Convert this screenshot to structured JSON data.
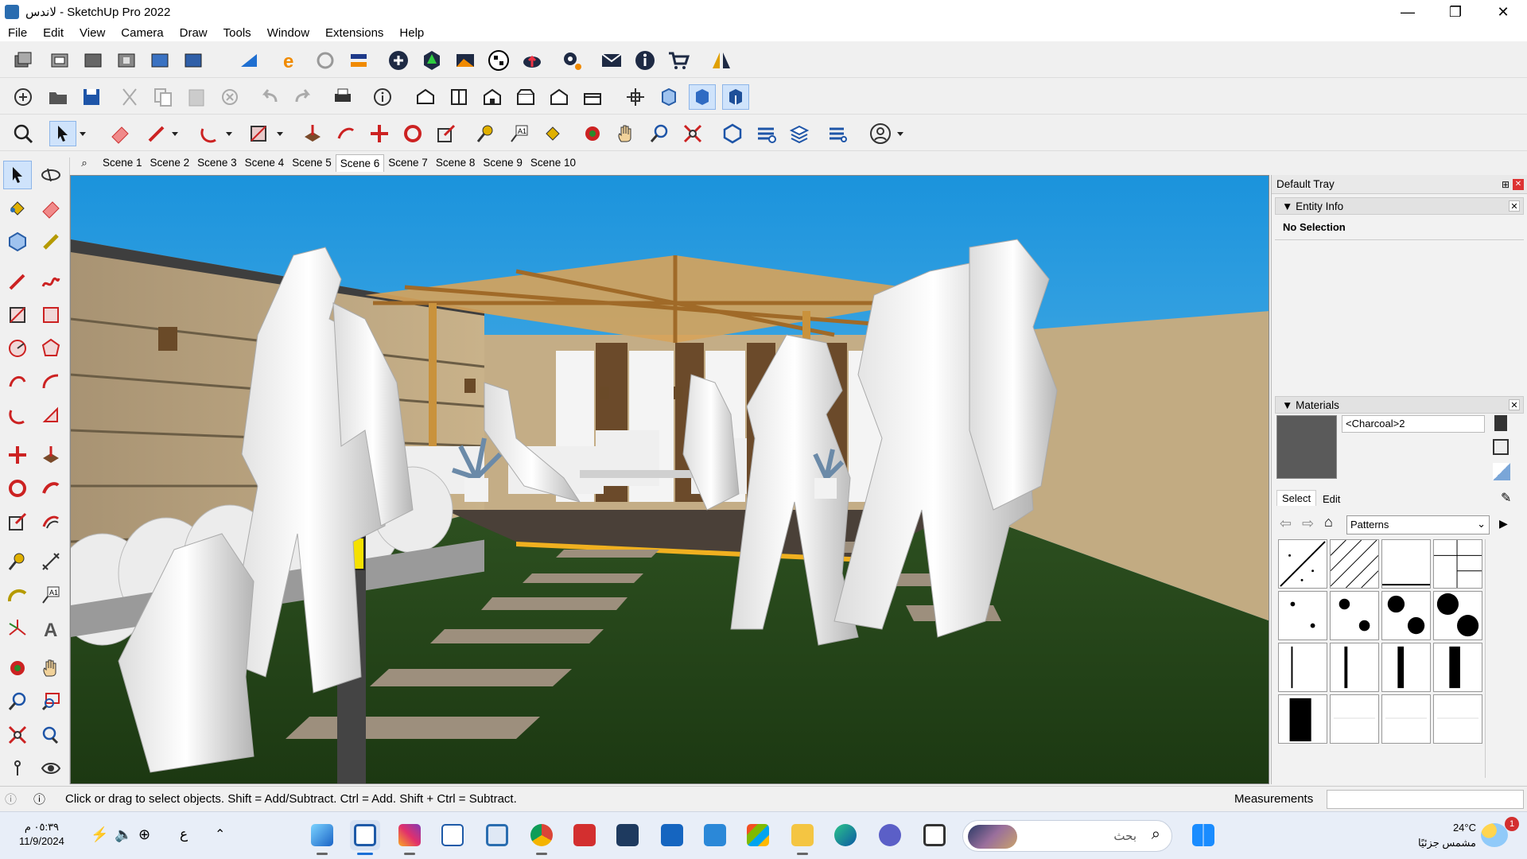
{
  "titlebar": {
    "title": "لاندس - SketchUp Pro 2022",
    "minimize": "—",
    "restore": "❐",
    "close": "✕"
  },
  "menu": [
    "File",
    "Edit",
    "View",
    "Camera",
    "Draw",
    "Tools",
    "Window",
    "Extensions",
    "Help"
  ],
  "scenes": {
    "search_icon": "magnifier-icon",
    "tabs": [
      "Scene 1",
      "Scene 2",
      "Scene 3",
      "Scene 4",
      "Scene 5",
      "Scene 6",
      "Scene 7",
      "Scene 8",
      "Scene 9",
      "Scene 10"
    ],
    "active": "Scene 6"
  },
  "tray": {
    "title": "Default Tray",
    "entity_info": {
      "title": "Entity Info",
      "status": "No Selection"
    },
    "materials": {
      "title": "Materials",
      "material_name": "<Charcoal>2",
      "material_color": "#5a5a5a",
      "tab_select": "Select",
      "tab_edit": "Edit",
      "library": "Patterns"
    }
  },
  "statusbar": {
    "message": "Click or drag to select objects. Shift = Add/Subtract. Ctrl = Add. Shift + Ctrl = Subtract.",
    "measurements_label": "Measurements",
    "measurements_value": ""
  },
  "taskbar": {
    "time": "٠٥:٣٩ م",
    "date": "11/9/2024",
    "lang": "ع",
    "search_placeholder": "بحث",
    "weather_temp": "24°C",
    "weather_desc": "مشمس جزئيًا",
    "notification_count": "1"
  },
  "colors": {
    "sky": "#2c9fe0",
    "grass": "#24421a",
    "wall": "#b9a27d",
    "wood": "#c9923c",
    "accent": "#1a6fd6"
  }
}
